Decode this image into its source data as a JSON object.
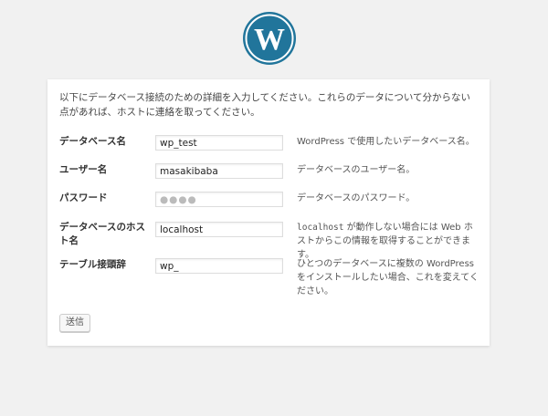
{
  "logo": {
    "icon": "wordpress-logo-icon",
    "color": "#21759b"
  },
  "intro": "以下にデータベース接続のための詳細を入力してください。これらのデータについて分からない点があれば、ホストに連絡を取ってください。",
  "fields": [
    {
      "label": "データベース名",
      "value": "wp_test",
      "desc": "WordPress で使用したいデータベース名。"
    },
    {
      "label": "ユーザー名",
      "value": "masakibaba",
      "desc": "データベースのユーザー名。"
    },
    {
      "label": "パスワード",
      "value": "●●●●",
      "desc": "データベースのパスワード。"
    },
    {
      "label": "データベースのホスト名",
      "value": "localhost",
      "desc_code": "localhost",
      "desc": " が動作しない場合には Web ホストからこの情報を取得することができます。"
    },
    {
      "label": "テーブル接頭辞",
      "value": "wp_",
      "desc": "ひとつのデータベースに複数の WordPress をインストールしたい場合、これを変えてください。"
    }
  ],
  "submit_label": "送信"
}
